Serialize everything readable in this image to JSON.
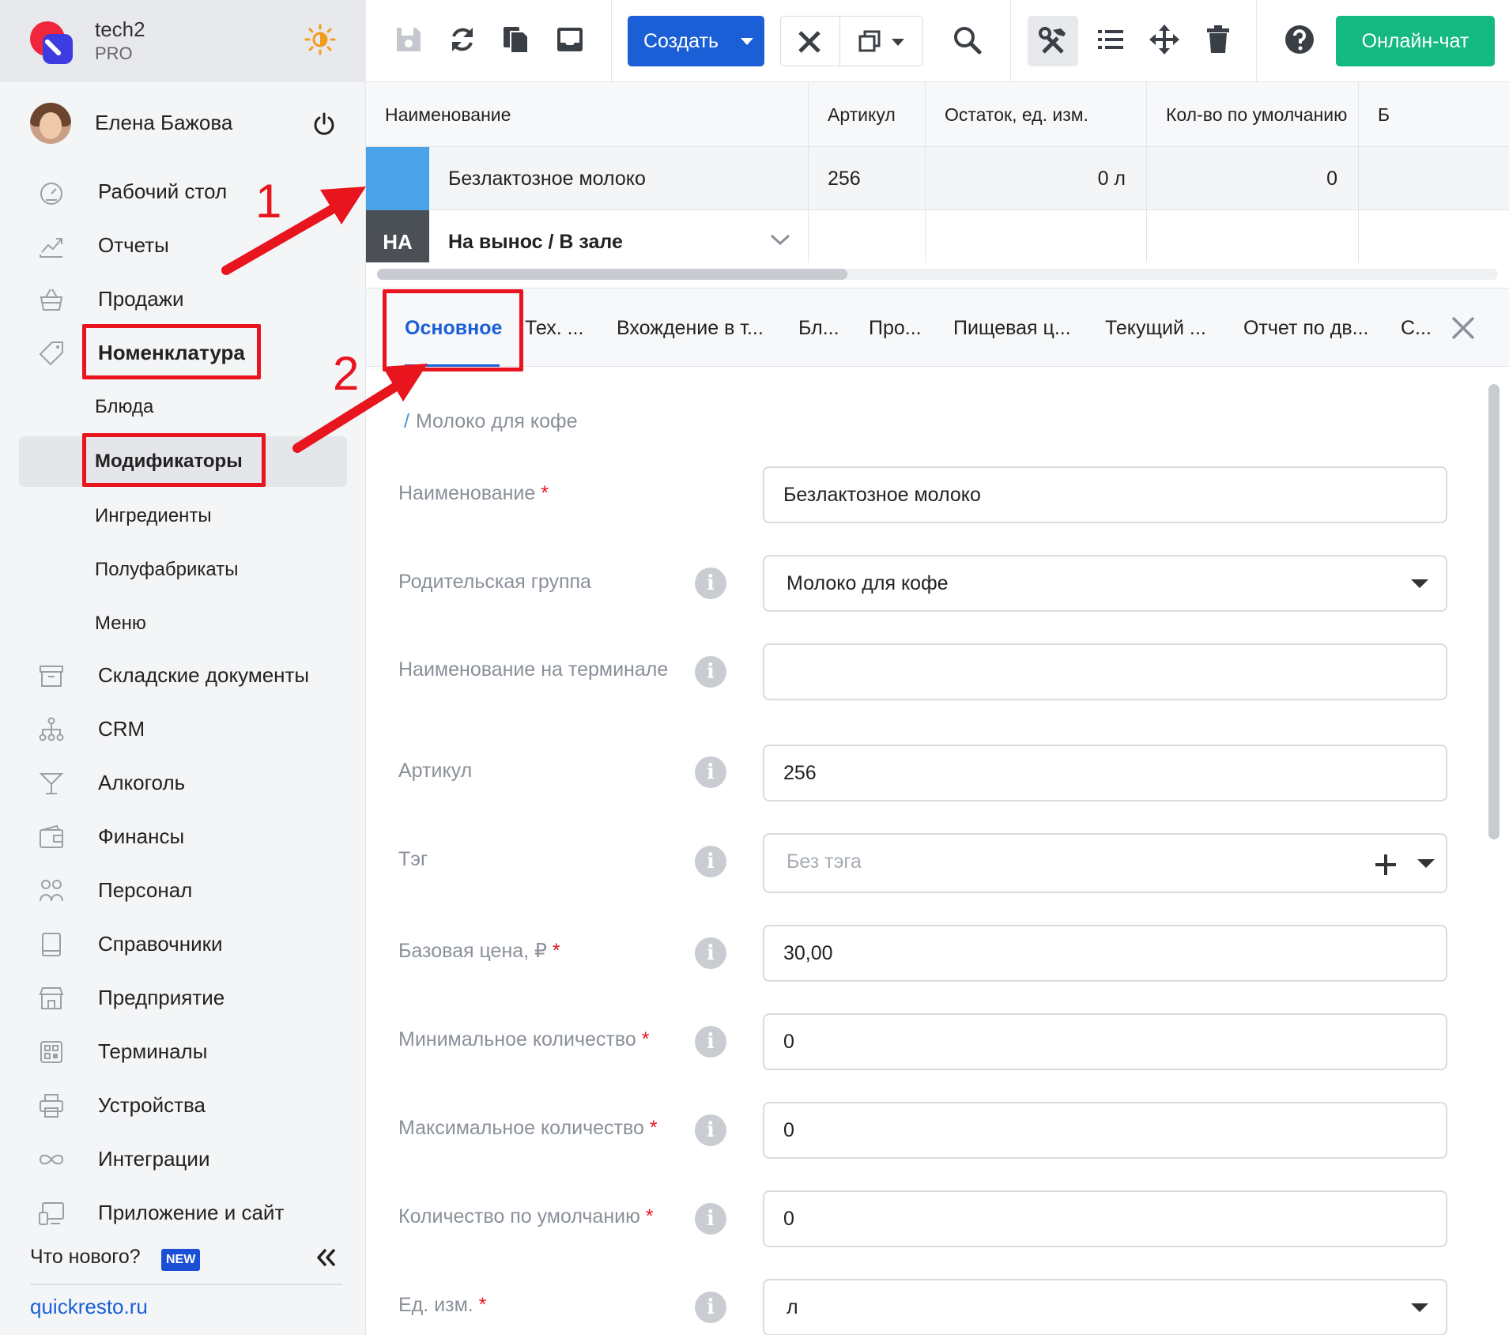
{
  "app": {
    "name": "tech2",
    "plan": "PRO"
  },
  "user": {
    "name": "Елена Бажова"
  },
  "sidebar": {
    "items": [
      {
        "label": "Рабочий стол",
        "icon": "speedometer-icon"
      },
      {
        "label": "Отчеты",
        "icon": "chart-icon"
      },
      {
        "label": "Продажи",
        "icon": "basket-icon"
      },
      {
        "label": "Номенклатура",
        "icon": "tag-icon"
      },
      {
        "label": "Складские документы",
        "icon": "archive-icon"
      },
      {
        "label": "CRM",
        "icon": "hierarchy-icon"
      },
      {
        "label": "Алкоголь",
        "icon": "cocktail-icon"
      },
      {
        "label": "Финансы",
        "icon": "wallet-icon"
      },
      {
        "label": "Персонал",
        "icon": "people-icon"
      },
      {
        "label": "Справочники",
        "icon": "book-icon"
      },
      {
        "label": "Предприятие",
        "icon": "store-icon"
      },
      {
        "label": "Терминалы",
        "icon": "qr-icon"
      },
      {
        "label": "Устройства",
        "icon": "printer-icon"
      },
      {
        "label": "Интеграции",
        "icon": "infinity-icon"
      },
      {
        "label": "Приложение и сайт",
        "icon": "devices-icon"
      }
    ],
    "subitems": [
      "Блюда",
      "Модификаторы",
      "Ингредиенты",
      "Полуфабрикаты",
      "Меню"
    ],
    "whats_new": "Что нового?",
    "new_badge": "NEW",
    "site_link": "quickresto.ru"
  },
  "toolbar": {
    "create_label": "Создать",
    "chat_label": "Онлайн-чат"
  },
  "grid": {
    "headers": [
      "Наименование",
      "Артикул",
      "Остаток, ед. изм.",
      "Кол-во по умолчанию",
      "Б"
    ],
    "row": {
      "name": "Безлактозное молоко",
      "article": "256",
      "stock": "0 л",
      "default_qty": "0"
    },
    "group_row": {
      "badge": "НА",
      "name": "На вынос / В зале"
    }
  },
  "tabs": [
    "Основное",
    "Тех. ...",
    "Вхождение в т...",
    "Бл...",
    "Про...",
    "Пищевая ц...",
    "Текущий ...",
    "Отчет по дв...",
    "С..."
  ],
  "form": {
    "breadcrumb": "Молоко для кофе",
    "fields": [
      {
        "label": "Наименование",
        "required": "*",
        "value": "Безлактозное молоко"
      },
      {
        "label": "Родительская группа",
        "required": "",
        "value": "Молоко для кофе"
      },
      {
        "label": "Наименование на терминале",
        "required": "",
        "value": ""
      },
      {
        "label": "Артикул",
        "required": "",
        "value": "256"
      },
      {
        "label": "Тэг",
        "required": "",
        "value": "",
        "placeholder": "Без тэга"
      },
      {
        "label": "Базовая цена, ₽",
        "required": "*",
        "value": "30,00"
      },
      {
        "label": "Минимальное количество",
        "required": "*",
        "value": "0"
      },
      {
        "label": "Максимальное количество",
        "required": "*",
        "value": "0"
      },
      {
        "label": "Количество по умолчанию",
        "required": "*",
        "value": "0"
      },
      {
        "label": "Ед. изм.",
        "required": "*",
        "value": "л"
      }
    ]
  },
  "annotations": {
    "step1": "1",
    "step2": "2"
  },
  "colors": {
    "accent": "#1a5fd6",
    "chat": "#14b982",
    "highlight": "#e8141e",
    "row_swatch": "#4aa3e8"
  }
}
